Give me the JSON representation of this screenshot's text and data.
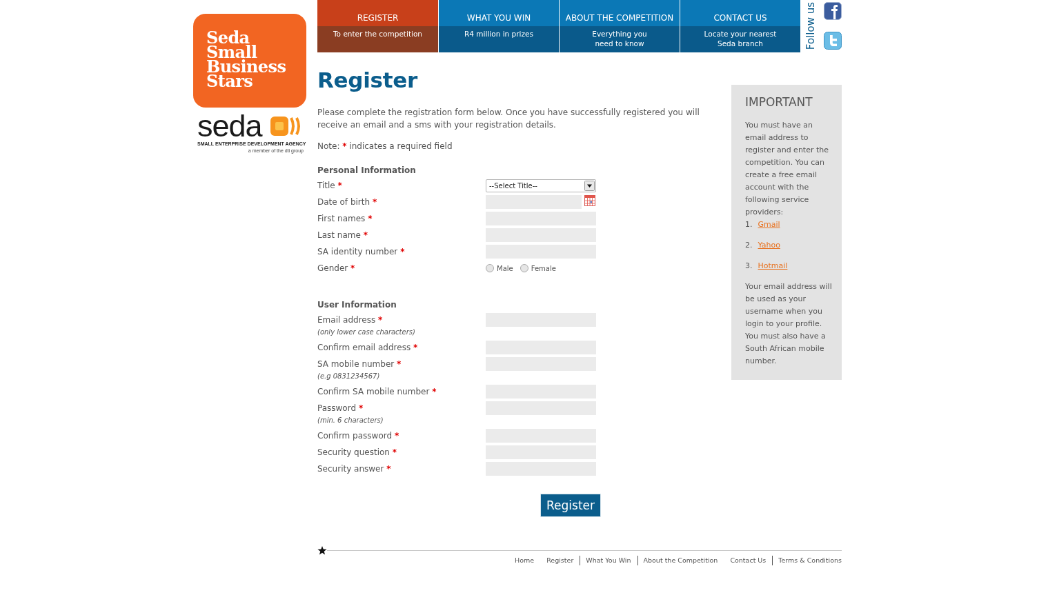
{
  "logo": {
    "title": "Seda Small Business Stars",
    "wordmark": "seda",
    "agency": "SMALL ENTERPRISE DEVELOPMENT AGENCY",
    "member_note": "a member of the dti group"
  },
  "nav": [
    {
      "label": "REGISTER",
      "subtitle_lines": [
        "To enter the competition"
      ],
      "selected": true
    },
    {
      "label": "WHAT YOU WIN",
      "subtitle_lines": [
        "R4 million in prizes"
      ],
      "selected": false
    },
    {
      "label": "ABOUT THE COMPETITION",
      "subtitle_lines": [
        "Everything you",
        "need to know"
      ],
      "selected": false
    },
    {
      "label": "CONTACT US",
      "subtitle_lines": [
        "Locate your nearest",
        "Seda branch"
      ],
      "selected": false
    }
  ],
  "follow_label": "Follow us",
  "page_title": "Register",
  "intro": "Please complete the registration form below. Once you have successfully registered you will receive an email and a sms with your registration details.",
  "note": {
    "label": "Note:",
    "mark": "*",
    "text": "indicates a required field"
  },
  "sections": [
    {
      "heading": "Personal Information",
      "fields": [
        {
          "kind": "select",
          "label": "Title",
          "mark": "*",
          "value": "--Select Title--"
        },
        {
          "kind": "date",
          "label": "Date of birth",
          "mark": "*"
        },
        {
          "kind": "text",
          "label": "First names",
          "mark": "*"
        },
        {
          "kind": "text",
          "label": "Last name",
          "mark": "*"
        },
        {
          "kind": "text",
          "label": "SA identity number",
          "mark": "*"
        },
        {
          "kind": "radio",
          "label": "Gender",
          "mark": "*",
          "options": [
            {
              "label": "Male",
              "selected": false
            },
            {
              "label": "Female",
              "selected": false
            }
          ]
        }
      ]
    },
    {
      "heading": "User Information",
      "fields": [
        {
          "kind": "text",
          "label": "Email address",
          "mark": "*",
          "hint": "(only lower case characters)"
        },
        {
          "kind": "text",
          "label": "Confirm email address",
          "mark": "*"
        },
        {
          "kind": "text",
          "label": "SA mobile number",
          "mark": "*",
          "hint": "(e.g 0831234567)"
        },
        {
          "kind": "text",
          "label": "Confirm SA mobile number",
          "mark": "*"
        },
        {
          "kind": "text",
          "label": "Password",
          "mark": "*",
          "hint": "(min. 6 characters)"
        },
        {
          "kind": "text",
          "label": "Confirm password",
          "mark": "*"
        },
        {
          "kind": "text",
          "label": "Security question",
          "mark": "*"
        },
        {
          "kind": "text",
          "label": "Security answer",
          "mark": "*"
        }
      ]
    }
  ],
  "submit_label": "Register",
  "sidebar": {
    "heading": "IMPORTANT",
    "intro": "You must have an email address to register and enter the competition. You can create a free email account with the following service providers:",
    "providers": [
      {
        "number": "1.",
        "label": "Gmail"
      },
      {
        "number": "2.",
        "label": "Yahoo"
      },
      {
        "number": "3.",
        "label": "Hotmail"
      }
    ],
    "outro": "Your email address will be used as your username when you login to your profile. You must also have a South African mobile number."
  },
  "footer_links": [
    {
      "label": "Home",
      "separator_before": false
    },
    {
      "label": "Register",
      "separator_before": false
    },
    {
      "label": "What You Win",
      "separator_before": true
    },
    {
      "label": "About the Competition",
      "separator_before": true
    },
    {
      "label": "Contact Us",
      "separator_before": false
    },
    {
      "label": "Terms & Conditions",
      "separator_before": true
    }
  ]
}
